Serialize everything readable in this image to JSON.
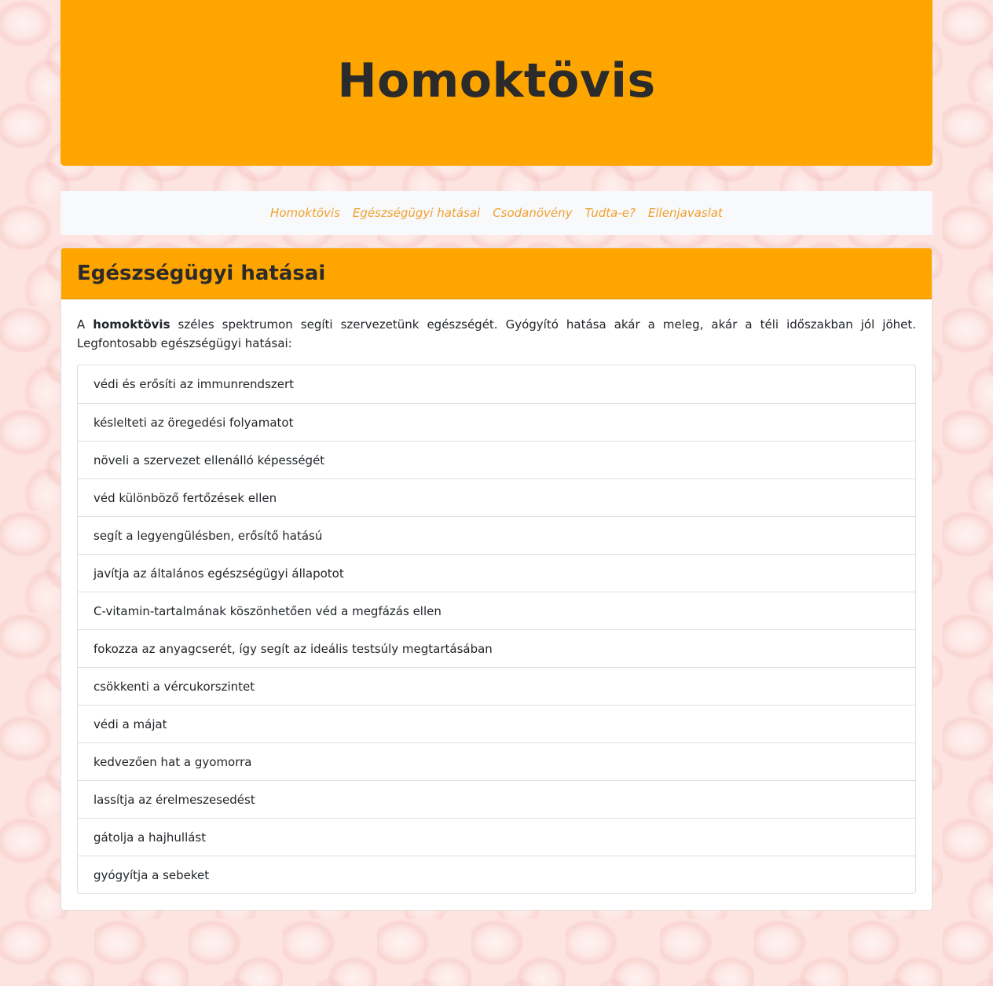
{
  "header": {
    "title": "Homoktövis"
  },
  "nav": {
    "items": [
      "Homoktövis",
      "Egészségügyi hatásai",
      "Csodanövény",
      "Tudta-e?",
      "Ellenjavaslat"
    ]
  },
  "card": {
    "title": "Egészségügyi hatásai",
    "intro_prefix": "A ",
    "intro_bold": "homoktövis",
    "intro_rest": " széles spektrumon segíti szervezetünk egészségét. Gyógyító hatása akár a meleg, akár a téli időszakban jól jöhet. Legfontosabb egészségügyi hatásai:",
    "items": [
      "védi és erősíti az immunrendszert",
      "késlelteti az öregedési folyamatot",
      "növeli a szervezet ellenálló képességét",
      "véd különböző fertőzések ellen",
      "segít a legyengülésben, erősítő hatású",
      "javítja az általános egészségügyi állapotot",
      "C-vitamin-tartalmának köszönhetően véd a megfázás ellen",
      "fokozza az anyagcserét, így segít az ideális testsúly megtartásában",
      "csökkenti a vércukorszintet",
      "védi a májat",
      "kedvezően hat a gyomorra",
      "lassítja az érelmeszesedést",
      "gátolja a hajhullást",
      "gyógyítja a sebeket"
    ]
  },
  "colors": {
    "accent": "#ffa500",
    "nav_link": "#f0a030",
    "nav_bg": "#f8f9fa"
  }
}
